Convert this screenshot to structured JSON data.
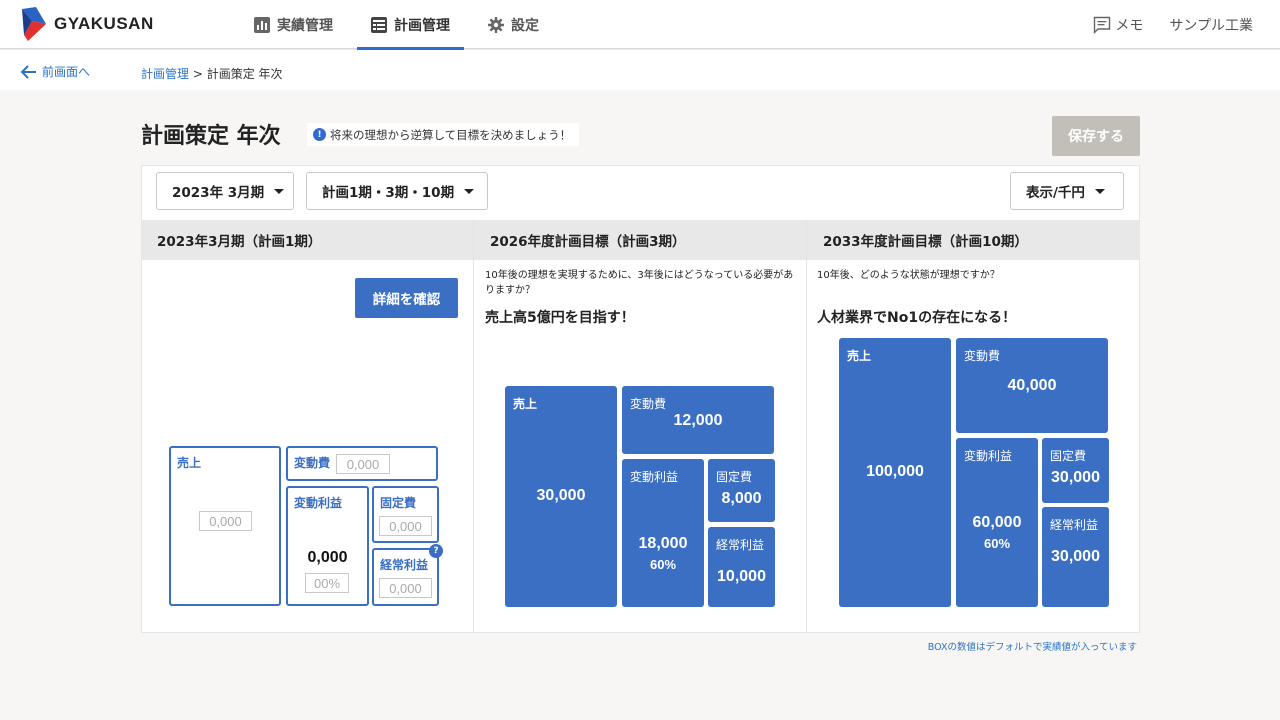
{
  "header": {
    "logo_text": "GYAKUSAN",
    "nav": [
      {
        "label": "実績管理",
        "icon": "bar-chart-icon",
        "active": false
      },
      {
        "label": "計画管理",
        "icon": "list-icon",
        "active": true
      },
      {
        "label": "設定",
        "icon": "gear-icon",
        "active": false
      }
    ],
    "memo_label": "メモ",
    "company": "サンプル工業"
  },
  "breadcrumb": {
    "back_label": "前画面へ",
    "parent": "計画管理",
    "separator": ">",
    "current": "計画策定 年次"
  },
  "page": {
    "title": "計画策定 年次",
    "hint": "将来の理想から逆算して目標を決めましょう！",
    "save_label": "保存する"
  },
  "filters": {
    "period": "2023年 3月期",
    "plans": "計画1期・3期・10期",
    "unit": "表示/千円"
  },
  "columns": [
    {
      "title": "2023年3月期（計画1期）",
      "detail_label": "詳細を確認",
      "boxes": {
        "sales": {
          "label": "売上",
          "value": "0,000"
        },
        "variable_cost": {
          "label": "変動費",
          "value": "0,000"
        },
        "marginal_profit": {
          "label": "変動利益",
          "value": "0,000",
          "rate": "00%"
        },
        "fixed_cost": {
          "label": "固定費",
          "value": "0,000"
        },
        "ordinary_profit": {
          "label": "経常利益",
          "value": "0,000"
        }
      }
    },
    {
      "title": "2026年度計画目標（計画3期）",
      "question": "10年後の理想を実現するために、3年後にはどうなっている必要がありますか？",
      "goal": "売上高5億円を目指す！",
      "boxes": {
        "sales": {
          "label": "売上",
          "value": "30,000"
        },
        "variable_cost": {
          "label": "変動費",
          "value": "12,000"
        },
        "marginal_profit": {
          "label": "変動利益",
          "value": "18,000",
          "rate": "60%"
        },
        "fixed_cost": {
          "label": "固定費",
          "value": "8,000"
        },
        "ordinary_profit": {
          "label": "経常利益",
          "value": "10,000"
        }
      }
    },
    {
      "title": "2033年度計画目標（計画10期）",
      "question": "10年後、どのような状態が理想ですか？",
      "goal": "人材業界でNo1の存在になる！",
      "boxes": {
        "sales": {
          "label": "売上",
          "value": "100,000"
        },
        "variable_cost": {
          "label": "変動費",
          "value": "40,000"
        },
        "marginal_profit": {
          "label": "変動利益",
          "value": "60,000",
          "rate": "60%"
        },
        "fixed_cost": {
          "label": "固定費",
          "value": "30,000"
        },
        "ordinary_profit": {
          "label": "経常利益",
          "value": "30,000"
        }
      }
    }
  ],
  "footnote": "BOXの数値はデフォルトで実績値が入っています",
  "colors": {
    "accent": "#3a6fc4",
    "link": "#2a74c6",
    "save_disabled": "#c2beb8"
  }
}
